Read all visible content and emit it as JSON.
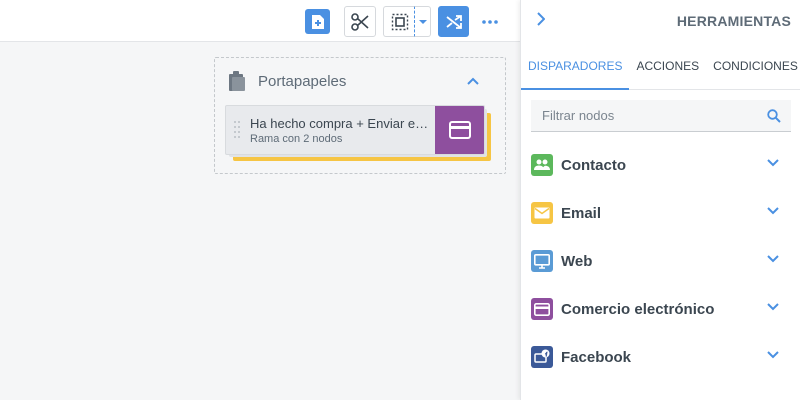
{
  "toolbar": {
    "new_icon": "file-plus-icon",
    "cut_icon": "scissors-icon",
    "select_icon": "select-area-icon",
    "caret_icon": "caret-down-icon",
    "shuffle_icon": "shuffle-icon",
    "more_icon": "more-horizontal-icon"
  },
  "clipboard": {
    "title": "Portapapeles",
    "node": {
      "title": "Ha hecho compra + Enviar e…",
      "subtitle": "Rama con 2 nodos",
      "icon": "credit-card-icon"
    }
  },
  "panel": {
    "title": "HERRAMIENTAS",
    "tabs": [
      {
        "label": "DISPARADORES",
        "active": true
      },
      {
        "label": "ACCIONES",
        "active": false
      },
      {
        "label": "CONDICIONES",
        "active": false
      }
    ],
    "search": {
      "placeholder": "Filtrar nodos",
      "value": ""
    },
    "categories": [
      {
        "label": "Contacto",
        "icon": "people-icon",
        "color": "#5cb85c"
      },
      {
        "label": "Email",
        "icon": "envelope-icon",
        "color": "#f6c544"
      },
      {
        "label": "Web",
        "icon": "monitor-icon",
        "color": "#5a9bd5"
      },
      {
        "label": "Comercio electrónico",
        "icon": "credit-card-icon",
        "color": "#8e4f9e"
      },
      {
        "label": "Facebook",
        "icon": "facebook-icon",
        "color": "#3b5998"
      }
    ]
  },
  "colors": {
    "accent": "#4a90e2",
    "text": "#3b4650",
    "muted": "#5e6b77",
    "ecommerce": "#8e4f9e",
    "email": "#f6c544"
  }
}
